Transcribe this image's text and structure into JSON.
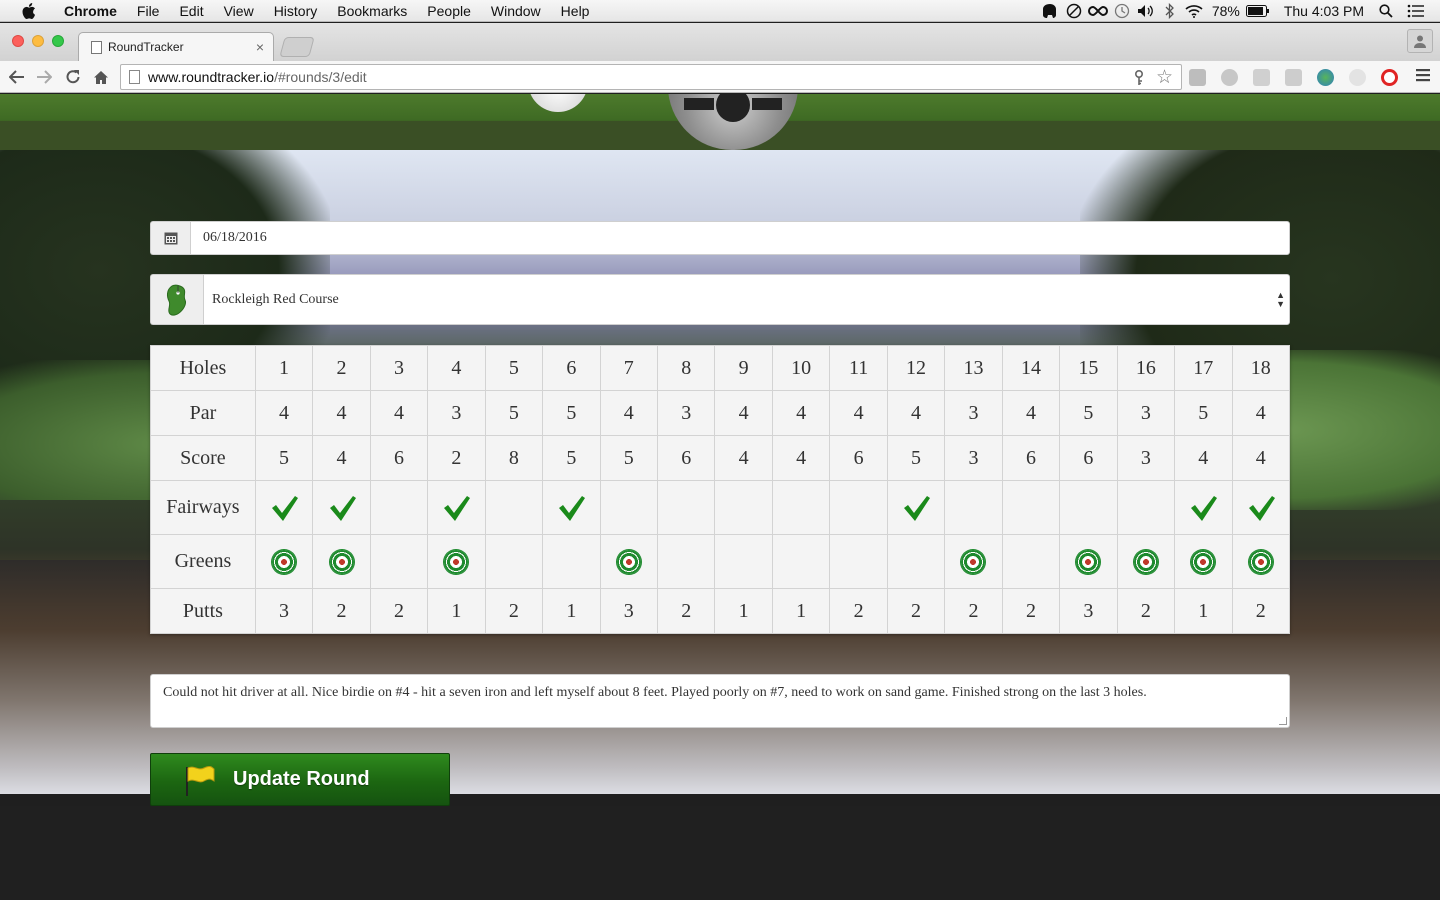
{
  "menubar": {
    "app": "Chrome",
    "items": [
      "File",
      "Edit",
      "View",
      "History",
      "Bookmarks",
      "People",
      "Window",
      "Help"
    ],
    "battery": "78%",
    "clock": "Thu 4:03 PM"
  },
  "browser": {
    "tab_title": "RoundTracker",
    "url_host": "www.roundtracker.io",
    "url_path": "/#rounds/3/edit"
  },
  "form": {
    "date": "06/18/2016",
    "course": "Rockleigh Red Course",
    "notes": "Could not hit driver at all.  Nice birdie on #4 - hit a seven iron and left myself about 8 feet.  Played poorly on #7, need to work on sand game.  Finished strong on the last 3 holes.",
    "submit_label": "Update Round"
  },
  "scorecard": {
    "row_labels": {
      "holes": "Holes",
      "par": "Par",
      "score": "Score",
      "fairways": "Fairways",
      "greens": "Greens",
      "putts": "Putts"
    },
    "holes": [
      "1",
      "2",
      "3",
      "4",
      "5",
      "6",
      "7",
      "8",
      "9",
      "10",
      "11",
      "12",
      "13",
      "14",
      "15",
      "16",
      "17",
      "18"
    ],
    "par": [
      "4",
      "4",
      "4",
      "3",
      "5",
      "5",
      "4",
      "3",
      "4",
      "4",
      "4",
      "4",
      "3",
      "4",
      "5",
      "3",
      "5",
      "4"
    ],
    "score": [
      "5",
      "4",
      "6",
      "2",
      "8",
      "5",
      "5",
      "6",
      "4",
      "4",
      "6",
      "5",
      "3",
      "6",
      "6",
      "3",
      "4",
      "4"
    ],
    "fairways": [
      true,
      true,
      false,
      true,
      false,
      true,
      false,
      false,
      false,
      false,
      false,
      true,
      false,
      false,
      false,
      false,
      true,
      true
    ],
    "greens": [
      true,
      true,
      false,
      true,
      false,
      false,
      true,
      false,
      false,
      false,
      false,
      false,
      true,
      false,
      true,
      true,
      true,
      true
    ],
    "putts": [
      "3",
      "2",
      "2",
      "1",
      "2",
      "1",
      "3",
      "2",
      "1",
      "1",
      "2",
      "2",
      "2",
      "2",
      "3",
      "2",
      "1",
      "2"
    ]
  },
  "colors": {
    "button_green": "#1c6611",
    "check_green": "#1a8a1a",
    "target_red": "#c0392b"
  }
}
